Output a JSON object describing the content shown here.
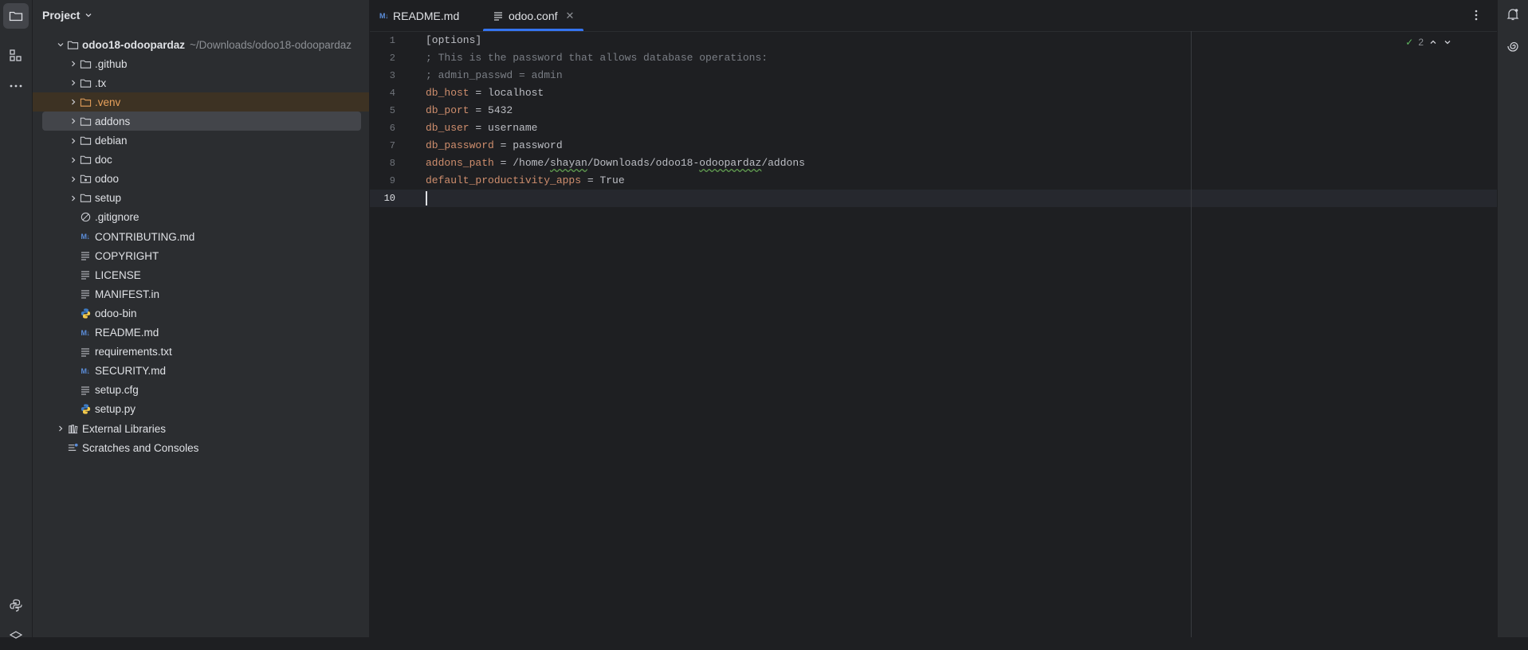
{
  "toolstrip": {
    "top": [
      {
        "name": "project-tool",
        "icon": "folder-icon",
        "active": true
      },
      {
        "name": "structure-tool",
        "icon": "structure-icon",
        "active": false
      },
      {
        "name": "more-tools",
        "icon": "more-icon",
        "active": false
      }
    ],
    "bottom": [
      {
        "name": "python-console-tool",
        "icon": "python-icon"
      },
      {
        "name": "layers-tool",
        "icon": "layers-icon"
      }
    ]
  },
  "project": {
    "title": "Project",
    "tree": [
      {
        "label": "odoo18-odoopardaz",
        "path": "~/Downloads/odoo18-odoopardaz",
        "type": "folder",
        "depth": 0,
        "expandable": true,
        "expanded": true,
        "bold": true
      },
      {
        "label": ".github",
        "type": "folder",
        "depth": 1,
        "expandable": true
      },
      {
        "label": ".tx",
        "type": "folder",
        "depth": 1,
        "expandable": true
      },
      {
        "label": ".venv",
        "type": "folder-excluded",
        "depth": 1,
        "expandable": true,
        "state": "excluded"
      },
      {
        "label": "addons",
        "type": "folder",
        "depth": 1,
        "expandable": true,
        "state": "selected"
      },
      {
        "label": "debian",
        "type": "folder",
        "depth": 1,
        "expandable": true
      },
      {
        "label": "doc",
        "type": "folder",
        "depth": 1,
        "expandable": true
      },
      {
        "label": "odoo",
        "type": "package",
        "depth": 1,
        "expandable": true
      },
      {
        "label": "setup",
        "type": "folder",
        "depth": 1,
        "expandable": true
      },
      {
        "label": ".gitignore",
        "type": "ignore",
        "depth": 1
      },
      {
        "label": "CONTRIBUTING.md",
        "type": "markdown",
        "depth": 1
      },
      {
        "label": "COPYRIGHT",
        "type": "text",
        "depth": 1
      },
      {
        "label": "LICENSE",
        "type": "text",
        "depth": 1
      },
      {
        "label": "MANIFEST.in",
        "type": "text",
        "depth": 1
      },
      {
        "label": "odoo-bin",
        "type": "python",
        "depth": 1
      },
      {
        "label": "README.md",
        "type": "markdown",
        "depth": 1
      },
      {
        "label": "requirements.txt",
        "type": "text",
        "depth": 1
      },
      {
        "label": "SECURITY.md",
        "type": "markdown",
        "depth": 1
      },
      {
        "label": "setup.cfg",
        "type": "text",
        "depth": 1
      },
      {
        "label": "setup.py",
        "type": "python",
        "depth": 1
      },
      {
        "label": "External Libraries",
        "type": "library",
        "depth": 0,
        "expandable": true
      },
      {
        "label": "Scratches and Consoles",
        "type": "scratches",
        "depth": 0
      }
    ]
  },
  "editor": {
    "tabs": [
      {
        "label": "README.md",
        "icon": "markdown-icon",
        "active": false
      },
      {
        "label": "odoo.conf",
        "icon": "text-file-icon",
        "active": true,
        "closable": true
      }
    ],
    "inspection": {
      "count": "2"
    },
    "lines": [
      {
        "n": "1",
        "parts": [
          {
            "t": "[options]",
            "c": "v"
          }
        ]
      },
      {
        "n": "2",
        "parts": [
          {
            "t": "; This is the password that allows database operations:",
            "c": "c"
          }
        ]
      },
      {
        "n": "3",
        "parts": [
          {
            "t": "; admin_passwd = admin",
            "c": "c"
          }
        ]
      },
      {
        "n": "4",
        "parts": [
          {
            "t": "db_host",
            "c": "k"
          },
          {
            "t": " = localhost",
            "c": "v"
          }
        ]
      },
      {
        "n": "5",
        "parts": [
          {
            "t": "db_port",
            "c": "k"
          },
          {
            "t": " = 5432",
            "c": "v"
          }
        ]
      },
      {
        "n": "6",
        "parts": [
          {
            "t": "db_user",
            "c": "k"
          },
          {
            "t": " = username",
            "c": "v"
          }
        ]
      },
      {
        "n": "7",
        "parts": [
          {
            "t": "db_password",
            "c": "k"
          },
          {
            "t": " = password",
            "c": "v"
          }
        ]
      },
      {
        "n": "8",
        "parts": [
          {
            "t": "addons_path",
            "c": "k"
          },
          {
            "t": " = /home/",
            "c": "v"
          },
          {
            "t": "shayan",
            "c": "v squig"
          },
          {
            "t": "/Downloads/odoo18-",
            "c": "v"
          },
          {
            "t": "odoopardaz",
            "c": "v squig"
          },
          {
            "t": "/addons",
            "c": "v"
          }
        ]
      },
      {
        "n": "9",
        "parts": [
          {
            "t": "default_productivity_apps",
            "c": "k"
          },
          {
            "t": " = True",
            "c": "v"
          }
        ]
      },
      {
        "n": "10",
        "parts": [],
        "current": true
      }
    ]
  },
  "rightstrip": [
    {
      "name": "notifications-tool",
      "icon": "bell-icon"
    },
    {
      "name": "ai-assistant-tool",
      "icon": "spiral-icon"
    }
  ]
}
